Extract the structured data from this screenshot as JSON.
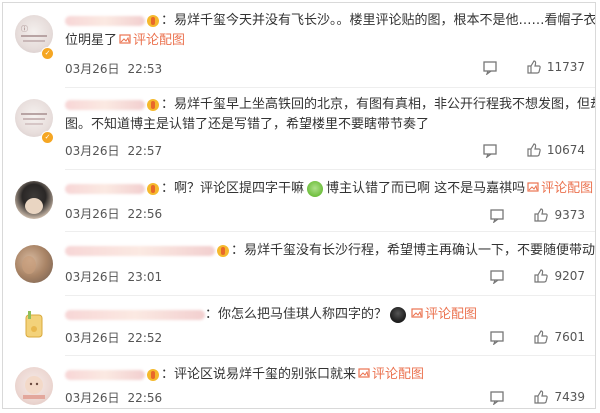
{
  "comments": [
    {
      "text1": "易烊千玺今天并没有飞长沙。。楼里评论贴的图，根本不是他……看帽子衣服就知道是哪",
      "text2": "位明星了",
      "link": "评论配图",
      "date": "03月26日",
      "time": "22:53",
      "likes": "11737"
    },
    {
      "text1": "易烊千玺早上坐高铁回的北京，有图有真相，非公开行程我不想发图，但却有必要可以补",
      "text2": "图。不知道博主是认错了还是写错了，希望楼里不要瞎带节奏了",
      "link": "",
      "date": "03月26日",
      "time": "22:57",
      "likes": "10674"
    },
    {
      "text1": "啊？评论区提四字干嘛",
      "text1b": "博主认错了而已啊 这不是马嘉祺吗",
      "link": "评论配图",
      "date": "03月26日",
      "time": "22:56",
      "likes": "9373"
    },
    {
      "text1": "易烊千玺没有长沙行程，希望博主再确认一下，不要随便带动网bao",
      "link": "",
      "date": "03月26日",
      "time": "23:01",
      "likes": "9207"
    },
    {
      "text1": "你怎么把马佳琪人称四字的？",
      "link": "评论配图",
      "date": "03月26日",
      "time": "22:52",
      "likes": "7601"
    },
    {
      "text1": "评论区说易烊千玺的别张口就来",
      "link": "评论配图",
      "date": "03月26日",
      "time": "22:56",
      "likes": "7439"
    }
  ],
  "icons": {
    "comment": "comment-icon",
    "like": "thumb-up-icon",
    "image_link": "image-icon"
  },
  "colors": {
    "link": "#eb7350",
    "vip_badge": "#f5b92d"
  }
}
